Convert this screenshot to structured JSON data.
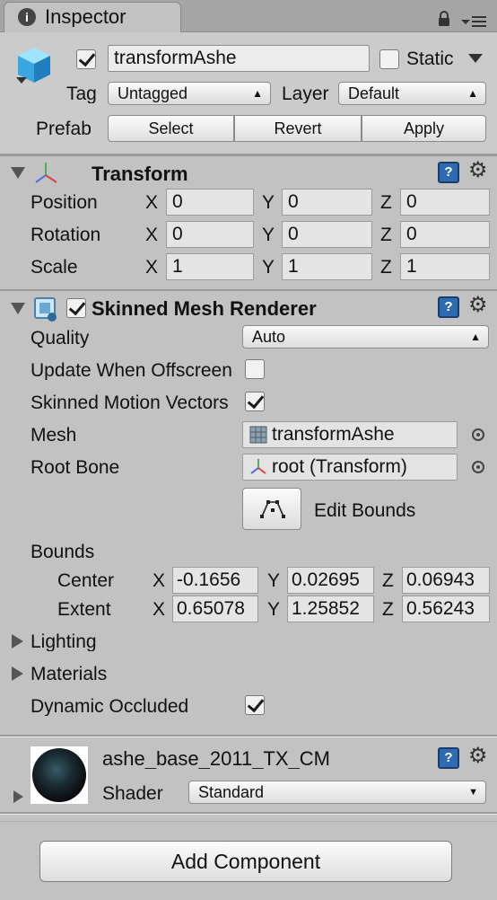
{
  "tab": {
    "title": "Inspector",
    "icon": "info-icon"
  },
  "header": {
    "object_name": "transformAshe",
    "active": true,
    "static_label": "Static",
    "static_checked": false,
    "tag_label": "Tag",
    "tag_value": "Untagged",
    "layer_label": "Layer",
    "layer_value": "Default",
    "prefab_label": "Prefab",
    "prefab_buttons": {
      "select": "Select",
      "revert": "Revert",
      "apply": "Apply"
    }
  },
  "transform": {
    "title": "Transform",
    "position": {
      "label": "Position",
      "x": "0",
      "y": "0",
      "z": "0"
    },
    "rotation": {
      "label": "Rotation",
      "x": "0",
      "y": "0",
      "z": "0"
    },
    "scale": {
      "label": "Scale",
      "x": "1",
      "y": "1",
      "z": "1"
    }
  },
  "axes": {
    "x": "X",
    "y": "Y",
    "z": "Z"
  },
  "smr": {
    "title": "Skinned Mesh Renderer",
    "enabled": true,
    "quality_label": "Quality",
    "quality_value": "Auto",
    "update_offscreen_label": "Update When Offscreen",
    "update_offscreen_checked": false,
    "motion_vectors_label": "Skinned Motion Vectors",
    "motion_vectors_checked": true,
    "mesh_label": "Mesh",
    "mesh_value": "transformAshe",
    "root_bone_label": "Root Bone",
    "root_bone_value": "root (Transform)",
    "edit_bounds_label": "Edit Bounds",
    "bounds_label": "Bounds",
    "center_label": "Center",
    "center": {
      "x": "-0.1656",
      "y": "0.02695",
      "z": "0.06943"
    },
    "extent_label": "Extent",
    "extent": {
      "x": "0.65078",
      "y": "1.25852",
      "z": "0.56243"
    },
    "lighting_label": "Lighting",
    "materials_label": "Materials",
    "dynamic_occluded_label": "Dynamic Occluded",
    "dynamic_occluded_checked": true
  },
  "material": {
    "name": "ashe_base_2011_TX_CM",
    "shader_label": "Shader",
    "shader_value": "Standard"
  },
  "add_component_label": "Add Component"
}
